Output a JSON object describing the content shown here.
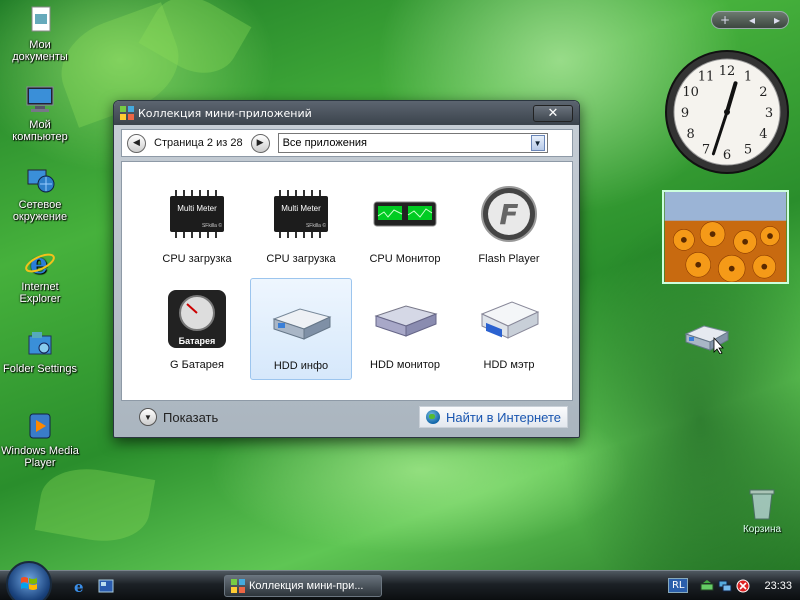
{
  "desktop": {
    "icons": [
      {
        "label": "Мои документы",
        "icon": "documents-icon"
      },
      {
        "label": "Мой компьютер",
        "icon": "computer-icon"
      },
      {
        "label": "Сетевое окружение",
        "icon": "network-icon"
      },
      {
        "label": "Internet Explorer",
        "icon": "ie-icon"
      },
      {
        "label": "Folder Settings",
        "icon": "folder-settings-icon"
      },
      {
        "label": "Windows Media Player",
        "icon": "media-player-icon"
      }
    ],
    "recycle_bin_label": "Корзина"
  },
  "sidebar": {
    "add_symbol": "+",
    "prev_symbol": "◂",
    "next_symbol": "▸"
  },
  "window": {
    "title": "Коллекция мини-приложений",
    "close_symbol": "✕",
    "page_label": "Страница 2 из 28",
    "filter_value": "Все приложения",
    "gadgets": [
      {
        "label": "CPU загрузка",
        "icon": "multi-meter-icon",
        "selected": false
      },
      {
        "label": "CPU загрузка",
        "icon": "multi-meter-icon",
        "selected": false
      },
      {
        "label": "CPU Монитор",
        "icon": "cpu-monitor-icon",
        "selected": false
      },
      {
        "label": "Flash Player",
        "icon": "flash-player-icon",
        "selected": false
      },
      {
        "label": "G Батарея",
        "icon": "battery-gauge-icon",
        "selected": false
      },
      {
        "label": "HDD инфо",
        "icon": "hdd-icon",
        "selected": true
      },
      {
        "label": "HDD монитор",
        "icon": "hdd-icon",
        "selected": false
      },
      {
        "label": "HDD мэтр",
        "icon": "hdd-icon",
        "selected": false
      }
    ],
    "meter_chip_text": "Multi Meter",
    "meter_chip_sub": "SFkilla ©",
    "battery_text": "Батарея",
    "show_label": "Показать",
    "online_label": "Найти в Интернете"
  },
  "clock": {
    "hour": 12,
    "minute": 33
  },
  "taskbar": {
    "window_button_label": "Коллекция мини-при...",
    "language": "RL",
    "time": "23:33"
  },
  "colors": {
    "accent": "#1a56b0",
    "selection": "#d6e8fb"
  }
}
